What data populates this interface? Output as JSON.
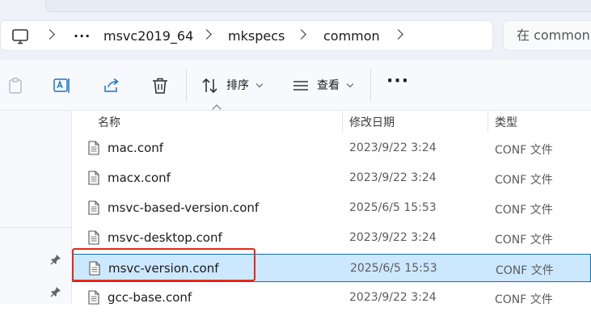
{
  "breadcrumb": {
    "items": [
      "msvc2019_64",
      "mkspecs",
      "common"
    ],
    "overflow_label": "···"
  },
  "search": {
    "placeholder": "在 common 中搜索"
  },
  "toolbar": {
    "sort_label": "排序",
    "view_label": "查看",
    "more_label": "···"
  },
  "columns": {
    "name": "名称",
    "modified": "修改日期",
    "type": "类型"
  },
  "files": [
    {
      "name": "mac.conf",
      "modified": "2023/9/22 3:24",
      "type": "CONF 文件"
    },
    {
      "name": "macx.conf",
      "modified": "2023/9/22 3:24",
      "type": "CONF 文件"
    },
    {
      "name": "msvc-based-version.conf",
      "modified": "2025/6/5 15:53",
      "type": "CONF 文件"
    },
    {
      "name": "msvc-desktop.conf",
      "modified": "2023/9/22 3:24",
      "type": "CONF 文件"
    },
    {
      "name": "msvc-version.conf",
      "modified": "2025/6/5 15:53",
      "type": "CONF 文件"
    },
    {
      "name": "gcc-base.conf",
      "modified": "2023/9/22 3:24",
      "type": "CONF 文件"
    }
  ],
  "selected_file": "msvc-version.conf",
  "colors": {
    "selection_bg": "#cce8ff",
    "selection_border": "#0f6cbd",
    "annotation_red": "#e8261c",
    "accent_blue": "#1a73c9"
  },
  "icons": {
    "computer": "computer-icon",
    "clipboard": "paste-icon",
    "rename": "rename-icon",
    "share": "share-icon",
    "delete": "delete-icon",
    "sort": "sort-icon",
    "view": "view-icon",
    "pin": "pin-icon",
    "file": "file-icon"
  }
}
